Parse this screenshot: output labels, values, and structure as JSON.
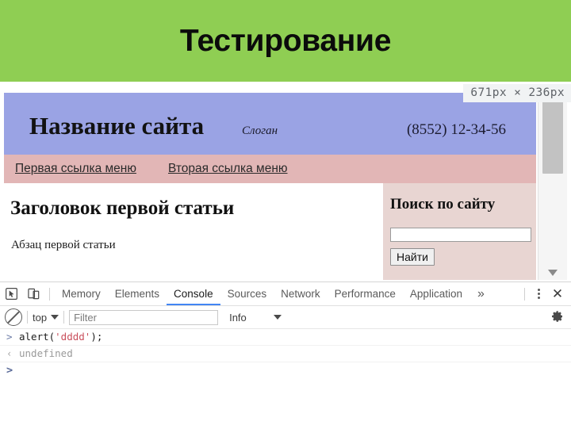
{
  "slide": {
    "title": "Тестирование",
    "banner_color": "#8fce53"
  },
  "browser": {
    "size_tooltip": "671px × 236px",
    "webpage": {
      "header": {
        "site_name": "Название сайта",
        "slogan": "Слоган",
        "phone": "(8552) 12-34-56",
        "bg_color": "#9aa3e4"
      },
      "nav": {
        "bg_color": "#e2b6b6",
        "links": [
          {
            "label": "Первая ссылка меню"
          },
          {
            "label": "Вторая ссылка меню"
          }
        ]
      },
      "article": {
        "heading": "Заголовок первой статьи",
        "paragraph": "Абзац первой статьи"
      },
      "sidebar": {
        "heading": "Поиск по сайту",
        "search_value": "",
        "search_placeholder": "",
        "search_button": "Найти",
        "bg_color": "#e8d5d2"
      }
    }
  },
  "devtools": {
    "toolbar": {
      "inspect_icon": "inspect-cursor-icon",
      "device_icon": "device-toolbar-icon",
      "tabs": [
        {
          "label": "Memory",
          "active": false
        },
        {
          "label": "Elements",
          "active": false
        },
        {
          "label": "Console",
          "active": true
        },
        {
          "label": "Sources",
          "active": false
        },
        {
          "label": "Network",
          "active": false
        },
        {
          "label": "Performance",
          "active": false
        },
        {
          "label": "Application",
          "active": false
        }
      ],
      "overflow": "»",
      "menu_icon": "kebab-menu-icon",
      "close_icon": "close-icon",
      "active_tab_color": "#4285f4"
    },
    "filterbar": {
      "clear_icon": "clear-console-icon",
      "context": "top",
      "filter_value": "",
      "filter_placeholder": "Filter",
      "level": "Info",
      "settings_icon": "gear-icon"
    },
    "console": {
      "rows": [
        {
          "marker": ">",
          "type": "input",
          "code_before": "alert(",
          "code_string": "'dddd'",
          "code_after": ");"
        },
        {
          "marker": "‹",
          "type": "result",
          "text": "undefined"
        }
      ],
      "prompt": ">",
      "string_color": "#c94f5c"
    }
  }
}
